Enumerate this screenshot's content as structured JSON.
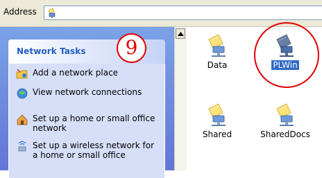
{
  "address_bar": {
    "label": "Address",
    "icon": "network-folder-icon"
  },
  "task_pane": {
    "title": "Network Tasks",
    "tasks": [
      {
        "label": "Add a network place",
        "icon": "add-network-place-icon"
      },
      {
        "label": "View network connections",
        "icon": "network-connections-icon"
      },
      {
        "label": "Set up a home or small office network",
        "icon": "home-network-icon"
      },
      {
        "label": "Set up a wireless network for a home or small office",
        "icon": "wireless-network-icon"
      }
    ]
  },
  "files": [
    {
      "label": "Data",
      "icon": "shared-folder-icon",
      "selected": false
    },
    {
      "label": "PLWin",
      "icon": "shared-folder-icon",
      "selected": true
    },
    {
      "label": "Shared",
      "icon": "shared-folder-icon",
      "selected": false
    },
    {
      "label": "SharedDocs",
      "icon": "shared-folder-icon",
      "selected": false
    }
  ],
  "annotation": {
    "step": "9",
    "color": "#e00000"
  }
}
